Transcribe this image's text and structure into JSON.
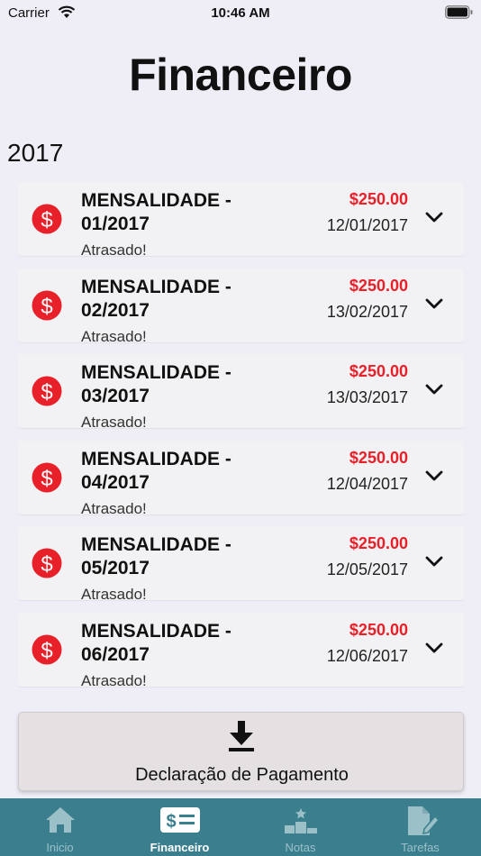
{
  "status_bar": {
    "carrier": "Carrier",
    "time": "10:46 AM"
  },
  "page": {
    "title": "Financeiro",
    "year": "2017"
  },
  "colors": {
    "accent_red": "#e8202a",
    "tabbar": "#3b7f8f",
    "background": "#efeef7"
  },
  "payments": [
    {
      "title": "MENSALIDADE - 01/2017",
      "amount": "$250.00",
      "date": "12/01/2017",
      "status": "Atrasado!"
    },
    {
      "title": "MENSALIDADE - 02/2017",
      "amount": "$250.00",
      "date": "13/02/2017",
      "status": "Atrasado!"
    },
    {
      "title": "MENSALIDADE - 03/2017",
      "amount": "$250.00",
      "date": "13/03/2017",
      "status": "Atrasado!"
    },
    {
      "title": "MENSALIDADE - 04/2017",
      "amount": "$250.00",
      "date": "12/04/2017",
      "status": "Atrasado!"
    },
    {
      "title": "MENSALIDADE - 05/2017",
      "amount": "$250.00",
      "date": "12/05/2017",
      "status": "Atrasado!"
    },
    {
      "title": "MENSALIDADE - 06/2017",
      "amount": "$250.00",
      "date": "12/06/2017",
      "status": "Atrasado!"
    }
  ],
  "declaration": {
    "label": "Declaração de Pagamento",
    "icon": "download-icon"
  },
  "tabs": [
    {
      "label": "Inicio",
      "icon": "home-icon",
      "active": false
    },
    {
      "label": "Financeiro",
      "icon": "money-icon",
      "active": true
    },
    {
      "label": "Notas",
      "icon": "podium-icon",
      "active": false
    },
    {
      "label": "Tarefas",
      "icon": "edit-document-icon",
      "active": false
    }
  ]
}
